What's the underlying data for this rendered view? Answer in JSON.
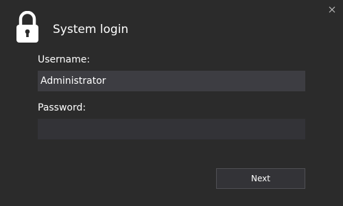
{
  "dialog": {
    "title": "System login",
    "icons": {
      "lock": "lock-icon",
      "close": "close-icon"
    }
  },
  "username": {
    "label": "Username:",
    "value": "Administrator"
  },
  "password": {
    "label": "Password:",
    "value": ""
  },
  "actions": {
    "next_label": "Next"
  },
  "colors": {
    "background": "#2b2b2b",
    "field_background": "#3d3d42",
    "text": "#ffffff"
  }
}
